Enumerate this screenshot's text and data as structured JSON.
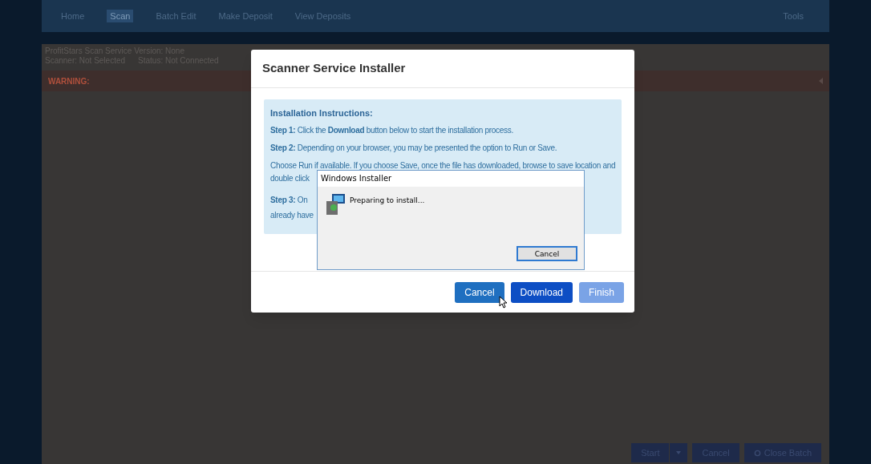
{
  "nav": {
    "items": [
      {
        "label": "Home",
        "selected": false
      },
      {
        "label": "Scan",
        "selected": true
      },
      {
        "label": "Batch Edit",
        "selected": false
      },
      {
        "label": "Make Deposit",
        "selected": false
      },
      {
        "label": "View Deposits",
        "selected": false
      }
    ],
    "tools": "Tools"
  },
  "status": {
    "version": "ProfitStars Scan Service Version: None",
    "scanner": "Scanner: Not Selected",
    "connection": "Status: Not Connected"
  },
  "warning": {
    "label": "WARNING:"
  },
  "bottom_buttons": [
    {
      "label": "Start",
      "kind": "split"
    },
    {
      "label": "Cancel",
      "kind": "plain"
    },
    {
      "label": "Close Batch",
      "kind": "icon"
    }
  ],
  "modal": {
    "title": "Scanner Service Installer",
    "instructions": {
      "heading": "Installation Instructions:",
      "lines": [
        "**Step 1:** Click the **Download** button below to start the installation process.",
        "**Step 2:** Depending on your browser, you may be presented the option to Run or Save.",
        "Choose Run if available. If you choose Save, once the file has downloaded, browse to save location and"
      ],
      "partial_lines": [
        "double click",
        "**Step 3:** On",
        "already have"
      ]
    },
    "buttons": [
      {
        "label": "Cancel",
        "kind": "secondary",
        "disabled": false
      },
      {
        "label": "Download",
        "kind": "primary",
        "disabled": false
      },
      {
        "label": "Finish",
        "kind": "primary",
        "disabled": true
      }
    ]
  },
  "installer": {
    "title": "Windows Installer",
    "message": "Preparing to install...",
    "button": "Cancel"
  }
}
